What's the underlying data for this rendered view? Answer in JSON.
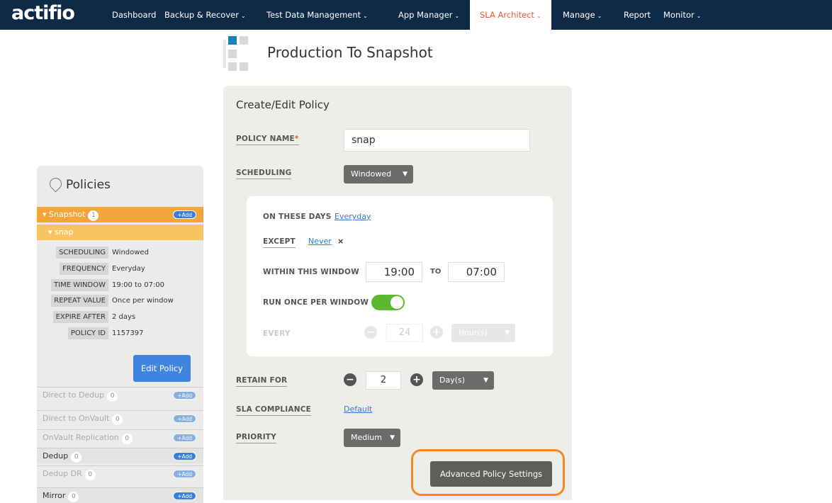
{
  "app": {
    "logo": "actifio"
  },
  "nav": {
    "items": [
      {
        "label": "Dashboard",
        "caret": ""
      },
      {
        "label": "Backup & Recover",
        "caret": "⌄"
      },
      {
        "label": "Test Data Management",
        "caret": "⌄"
      },
      {
        "label": "App Manager",
        "caret": "⌄"
      },
      {
        "label": "SLA Architect",
        "caret": "⌄"
      },
      {
        "label": "Manage",
        "caret": "⌄"
      },
      {
        "label": "Report",
        "caret": ""
      },
      {
        "label": "Monitor",
        "caret": "⌄"
      }
    ],
    "active": "SLA Architect"
  },
  "page": {
    "title": "Production To Snapshot"
  },
  "form": {
    "heading": "Create/Edit Policy",
    "policy_name_label": "POLICY NAME",
    "required_mark": "*",
    "policy_name_value": "snap",
    "scheduling_label": "SCHEDULING",
    "scheduling_value": "Windowed",
    "on_these_days_label": "ON THESE DAYS",
    "on_these_days_value": "Everyday",
    "except_label": "EXCEPT",
    "except_value": "Never",
    "except_clear": "×",
    "window_label": "WITHIN THIS WINDOW",
    "window_start": "19:00",
    "window_to": "TO",
    "window_end": "07:00",
    "run_once_label": "RUN ONCE PER WINDOW",
    "run_once_enabled": true,
    "every_label": "EVERY",
    "every_value": "24",
    "every_unit": "Hour(s)",
    "retain_label": "RETAIN FOR",
    "retain_value": "2",
    "retain_unit": "Day(s)",
    "sla_label": "SLA COMPLIANCE",
    "sla_value": "Default",
    "priority_label": "PRIORITY",
    "priority_value": "Medium",
    "minus_symbol": "−",
    "plus_symbol": "+",
    "caret_symbol": "▼",
    "advanced_button": "Advanced Policy Settings"
  },
  "sidebar": {
    "title": "Policies",
    "add_label": "+Add",
    "snapshot": {
      "label": "Snapshot",
      "count": "1"
    },
    "policy": {
      "label": "snap"
    },
    "details": [
      {
        "key": "SCHEDULING",
        "value": "Windowed"
      },
      {
        "key": "FREQUENCY",
        "value": "Everyday"
      },
      {
        "key": "TIME WINDOW",
        "value": "19:00 to 07:00"
      },
      {
        "key": "REPEAT VALUE",
        "value": "Once per window"
      },
      {
        "key": "EXPIRE AFTER",
        "value": "2 days"
      },
      {
        "key": "POLICY ID",
        "value": "1157397"
      }
    ],
    "edit_button": "Edit Policy",
    "categories": [
      {
        "label": "Direct to Dedup",
        "count": "0"
      },
      {
        "label": "Direct to OnVault",
        "count": "0"
      },
      {
        "label": "OnVault Replication",
        "count": "0"
      },
      {
        "label": "Dedup",
        "count": "0"
      },
      {
        "label": "Dedup DR",
        "count": "0"
      },
      {
        "label": "Mirror",
        "count": "0"
      }
    ]
  }
}
